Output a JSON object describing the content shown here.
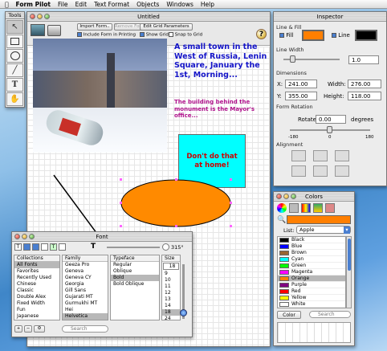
{
  "menubar": {
    "app": "Form Pilot",
    "items": [
      "File",
      "Edit",
      "Text Format",
      "Objects",
      "Windows",
      "Help"
    ]
  },
  "tools": {
    "title": "Tools",
    "items": [
      "arrow-icon",
      "rectangle-icon",
      "ellipse-icon",
      "line-icon",
      "text-icon",
      "hand-icon"
    ]
  },
  "document": {
    "title": "Untitled",
    "import_form": "Import Form..",
    "remove_form": "Remove Form",
    "include_printing": "Include Form in Printing",
    "edit_grid": "Edit Grid Parameters",
    "show_grid": "Show Grid",
    "snap_grid": "Snap to Grid",
    "help": "?"
  },
  "canvas": {
    "headline": "A small town in the West of Russia, Lenin Square, January the 1st, Morning...",
    "subtext": "The building behind the monument is the Mayor's office...",
    "callout": "Don't do that at home!",
    "headline_color": "#1414c8",
    "subtext_color": "#b0128c",
    "callout_fill": "#00ffff",
    "callout_text_color": "#cc0000",
    "ellipse_fill": "#ff8a00"
  },
  "inspector": {
    "title": "Inspector",
    "line_fill": "Line & Fill",
    "fill_label": "Fill",
    "fill_color": "#ff7f00",
    "line_label": "Line",
    "line_color": "#000000",
    "line_width_label": "Line Width",
    "line_width": "1.0",
    "dimensions": "Dimensions",
    "x_label": "X:",
    "x": "241.00",
    "y_label": "Y:",
    "y": "355.00",
    "width_label": "Width:",
    "width": "276.00",
    "height_label": "Height:",
    "height": "118.00",
    "form_rotation": "Form Rotation",
    "rotate_label": "Rotate:",
    "rotate": "0.00",
    "degrees": "degrees",
    "rot_min": "-180",
    "rot_mid": "0",
    "rot_max": "180",
    "alignment": "Alignment"
  },
  "colors": {
    "title": "Colors",
    "current": "#ff7f00",
    "list_label": "List:",
    "list_value": "Apple",
    "items": [
      {
        "name": "Black",
        "hex": "#000000"
      },
      {
        "name": "Blue",
        "hex": "#0000ff"
      },
      {
        "name": "Brown",
        "hex": "#996633"
      },
      {
        "name": "Cyan",
        "hex": "#00ffff"
      },
      {
        "name": "Green",
        "hex": "#00ff00"
      },
      {
        "name": "Magenta",
        "hex": "#ff00ff"
      },
      {
        "name": "Orange",
        "hex": "#ff8000"
      },
      {
        "name": "Purple",
        "hex": "#800080"
      },
      {
        "name": "Red",
        "hex": "#ff0000"
      },
      {
        "name": "Yellow",
        "hex": "#ffff00"
      },
      {
        "name": "White",
        "hex": "#ffffff"
      }
    ],
    "selected": "Orange",
    "color_button": "Color",
    "search": "Search"
  },
  "font": {
    "title": "Font",
    "angle": "315°",
    "col_collections": "Collections",
    "col_family": "Family",
    "col_typeface": "Typeface",
    "col_size": "Size",
    "size_value": "18",
    "collections": [
      "All Fonts",
      "Favorites",
      "Recently Used",
      "Chinese",
      "Classic",
      "Double Alex",
      "Fixed Width",
      "Fun",
      "Japanese"
    ],
    "families": [
      "Geeza Pro",
      "Geneva",
      "Geneva CY",
      "Georgia",
      "Gill Sans",
      "Gujarati MT",
      "Gurmukhi MT",
      "Hei",
      "Helvetica"
    ],
    "typefaces": [
      "Regular",
      "Oblique",
      "Bold",
      "Bold Oblique"
    ],
    "sizes": [
      "9",
      "10",
      "11",
      "12",
      "13",
      "14",
      "18",
      "24"
    ],
    "search": "Search"
  }
}
